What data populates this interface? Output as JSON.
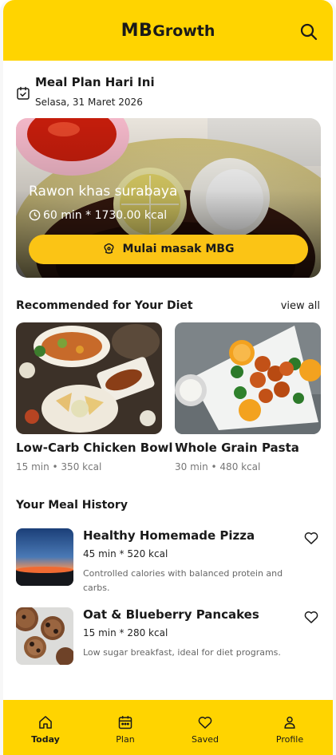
{
  "app": {
    "logo_part1": "MB",
    "logo_part2": "Growth"
  },
  "meal_plan": {
    "title": "Meal Plan Hari Ini",
    "date": "Selasa, 31 Maret 2026",
    "dish_name": "Rawon khas surabaya",
    "meta": "60 min * 1730.00 kcal",
    "cta_label": "Mulai masak MBG"
  },
  "recommended": {
    "title": "Recommended for Your Diet",
    "view_all": "view all",
    "items": [
      {
        "name": "Low-Carb Chicken Bowl",
        "meta": "15 min • 350 kcal"
      },
      {
        "name": "Whole Grain Pasta",
        "meta": "30 min • 480 kcal"
      }
    ]
  },
  "history": {
    "title": "Your Meal History",
    "items": [
      {
        "name": "Healthy Homemade Pizza",
        "meta": "45 min * 520 kcal",
        "desc": "Controlled calories with balanced protein and carbs."
      },
      {
        "name": "Oat & Blueberry Pancakes",
        "meta": "15 min * 280 kcal",
        "desc": "Low sugar breakfast, ideal for diet programs."
      }
    ]
  },
  "nav": {
    "items": [
      {
        "label": "Today",
        "icon": "home-icon"
      },
      {
        "label": "Plan",
        "icon": "calendar-icon"
      },
      {
        "label": "Saved",
        "icon": "heart-icon"
      },
      {
        "label": "Profile",
        "icon": "user-icon"
      }
    ]
  },
  "colors": {
    "brand_yellow": "#ffd400",
    "button_yellow": "#fbc415"
  }
}
